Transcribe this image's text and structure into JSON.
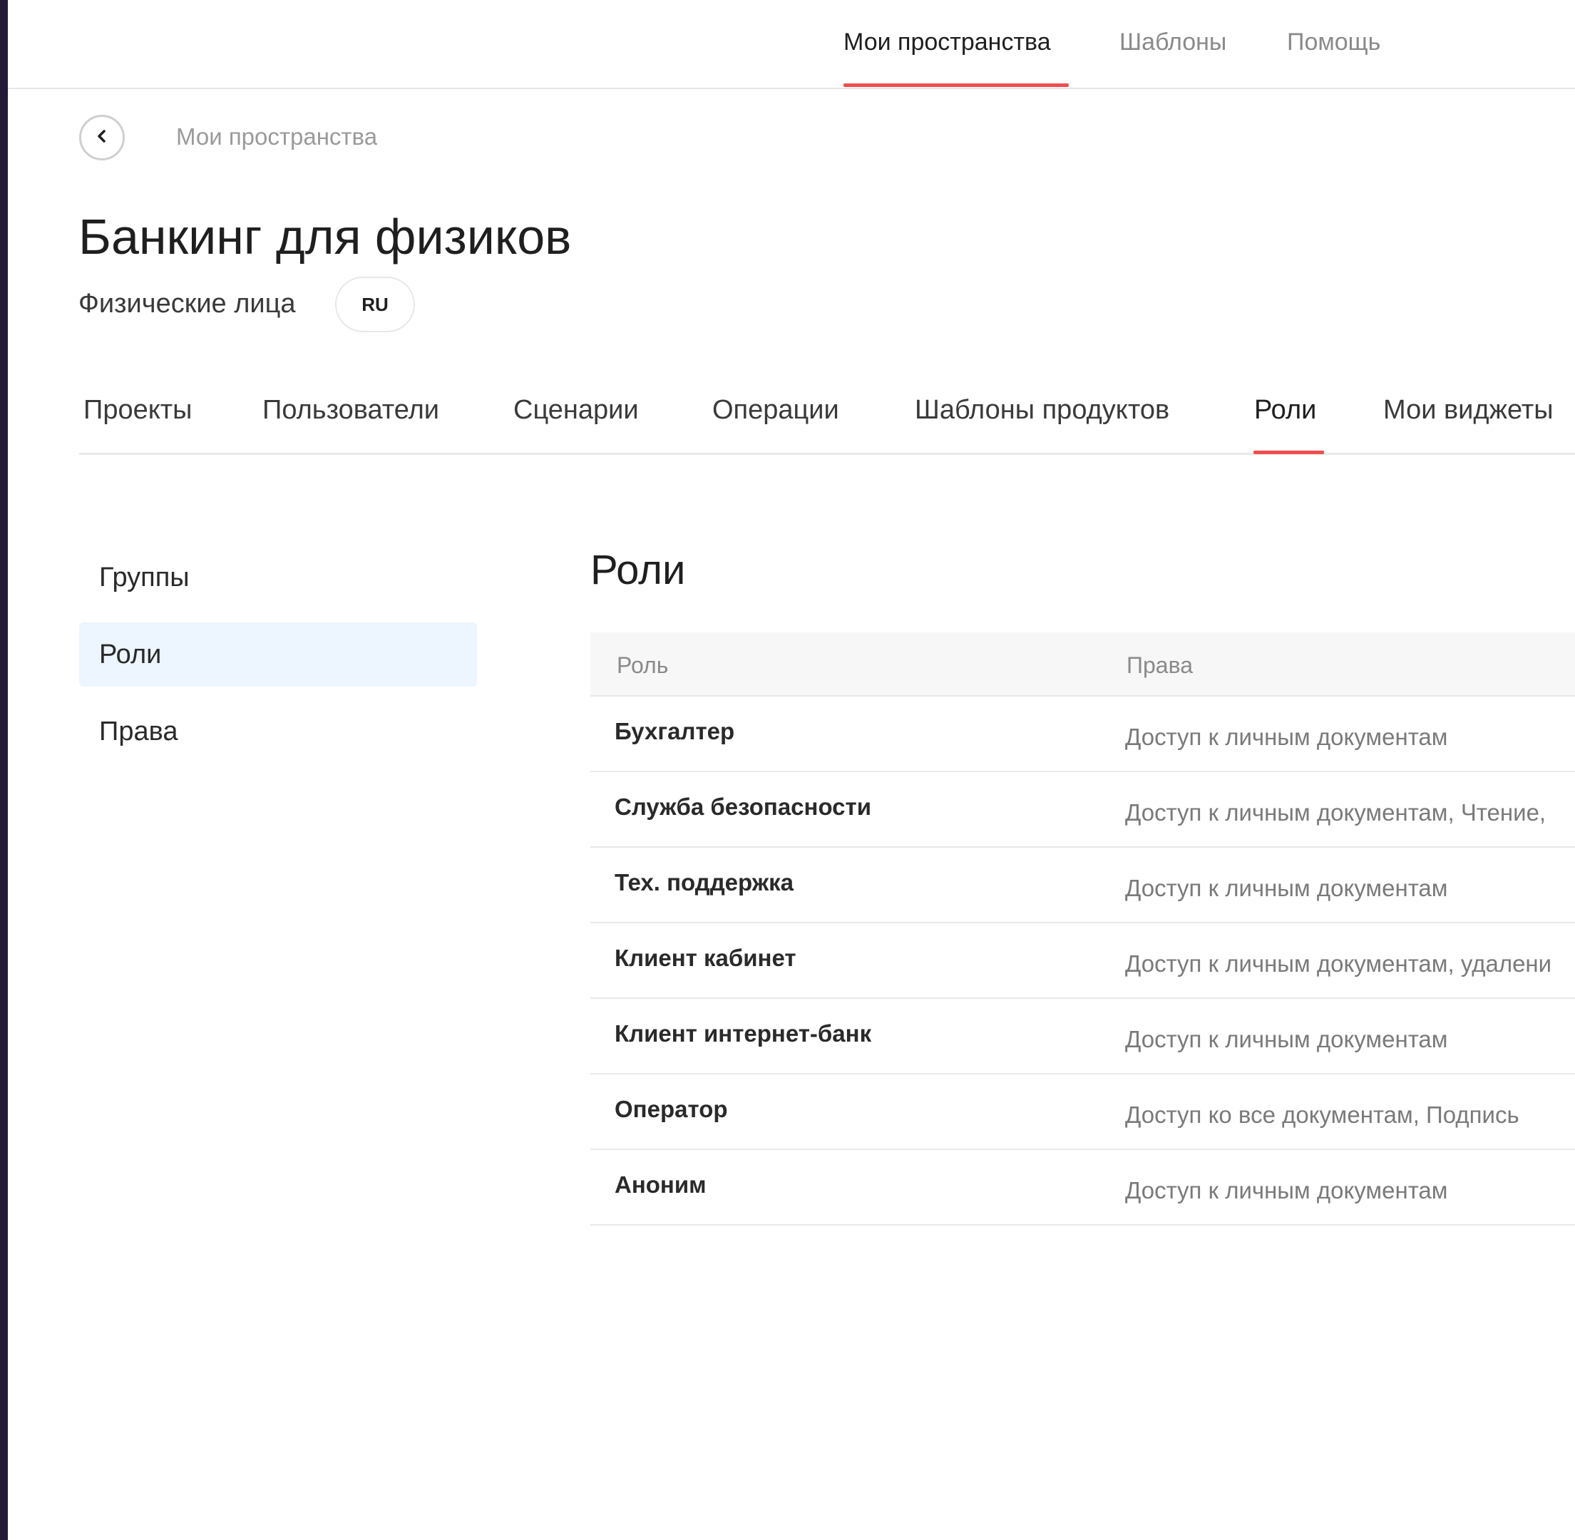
{
  "topnav": {
    "items": [
      {
        "label": "Мои пространства",
        "active": true
      },
      {
        "label": "Шаблоны",
        "active": false
      },
      {
        "label": "Помощь",
        "active": false
      }
    ]
  },
  "breadcrumb": {
    "label": "Мои пространства"
  },
  "header": {
    "title": "Банкинг для физиков",
    "subtitle": "Физические лица",
    "badge": "RU"
  },
  "tabs": [
    {
      "label": "Проекты"
    },
    {
      "label": "Пользователи"
    },
    {
      "label": "Сценарии"
    },
    {
      "label": "Операции"
    },
    {
      "label": "Шаблоны продуктов"
    },
    {
      "label": "Роли",
      "active": true
    },
    {
      "label": "Мои виджеты"
    }
  ],
  "side_menu": [
    {
      "label": "Группы"
    },
    {
      "label": "Роли",
      "active": true
    },
    {
      "label": "Права"
    }
  ],
  "content": {
    "title": "Роли",
    "columns": [
      "Роль",
      "Права"
    ],
    "rows": [
      {
        "role": "Бухгалтер",
        "rights": "Доступ к личным документам"
      },
      {
        "role": "Служба безопасности",
        "rights": "Доступ к личным документам, Чтение,"
      },
      {
        "role": "Тех. поддержка",
        "rights": "Доступ к личным документам"
      },
      {
        "role": "Клиент кабинет",
        "rights": "Доступ к личным документам, удалени"
      },
      {
        "role": "Клиент интернет-банк",
        "rights": "Доступ к личным документам"
      },
      {
        "role": "Оператор",
        "rights": "Доступ ко все документам, Подпись"
      },
      {
        "role": "Аноним",
        "rights": "Доступ к личным документам"
      }
    ]
  },
  "colors": {
    "accent": "#ef4d50",
    "selected_bg": "#edf5fe",
    "left_edge": "#221a38"
  },
  "icons": {
    "back": "chevron-left-icon"
  }
}
